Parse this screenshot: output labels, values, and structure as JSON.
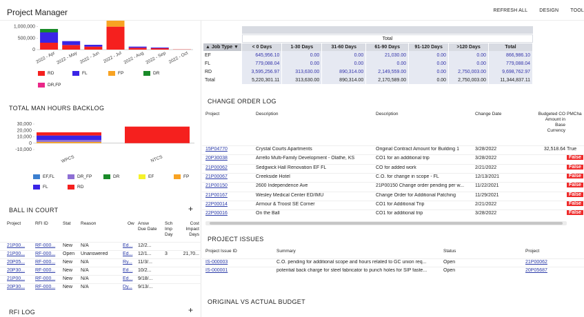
{
  "app": {
    "title": "Project Manager",
    "actions": [
      "REFRESH ALL",
      "DESIGN",
      "TOOL"
    ]
  },
  "colors": {
    "RD": "#f5201e",
    "FL": "#3a24e6",
    "FP": "#f8a323",
    "DR": "#198a28",
    "DR,FP": "#ea2788",
    "EF,FL": "#3b7fcf",
    "DR_FP": "#8e6fd4",
    "EF": "#f5f22a"
  },
  "invoice_chart": {
    "chart_data": {
      "type": "bar",
      "stacked": true,
      "categories": [
        "2022 - Apr",
        "2022 - May",
        "2022 - Jun",
        "2022 - Jul",
        "2022 - Aug",
        "2022 - Sep",
        "2022 - Oct"
      ],
      "series": [
        {
          "name": "RD",
          "values": [
            300000,
            200000,
            130000,
            1000000,
            80000,
            60000,
            10000
          ]
        },
        {
          "name": "FL",
          "values": [
            450000,
            170000,
            80000,
            0,
            50000,
            30000,
            0
          ]
        },
        {
          "name": "FP",
          "values": [
            0,
            0,
            0,
            450000,
            0,
            0,
            0
          ]
        },
        {
          "name": "DR",
          "values": [
            150000,
            0,
            0,
            0,
            0,
            0,
            0
          ]
        },
        {
          "name": "DR,FP",
          "values": [
            0,
            0,
            0,
            0,
            0,
            0,
            0
          ]
        }
      ],
      "ticks": [
        "0",
        "500,000",
        "1,000,000"
      ],
      "ylim": [
        0,
        1200000
      ],
      "legend": [
        "RD",
        "FL",
        "FP",
        "DR",
        "DR,FP"
      ]
    }
  },
  "backlog": {
    "title": "TOTAL MAN HOURS BACKLOG",
    "chart_data": {
      "type": "bar",
      "stacked": true,
      "categories": [
        "WPCS",
        "NTCS"
      ],
      "series": [
        {
          "name": "RD",
          "values": [
            5000,
            26000
          ]
        },
        {
          "name": "FL",
          "values": [
            7000,
            0
          ]
        },
        {
          "name": "DR_FP",
          "values": [
            3000,
            0
          ]
        },
        {
          "name": "FP",
          "values": [
            2000,
            0
          ]
        },
        {
          "name": "EF,FL",
          "values": [
            0,
            0
          ]
        }
      ],
      "ticks": [
        "-10,000",
        "0",
        "10,000",
        "20,000",
        "30,000"
      ],
      "ylim": [
        -10000,
        30000
      ],
      "legend": [
        "EF,FL",
        "DR_FP",
        "DR",
        "EF",
        "FP",
        "FL",
        "RD"
      ]
    }
  },
  "ball_in_court": {
    "title": "BALL IN COURT",
    "headers": [
      "Project",
      "RFI ID",
      "Stat",
      "Reason",
      "Ow",
      "Answ Due Date",
      "Sch Imp Day",
      "Cost Impact Days"
    ],
    "rows": [
      [
        "21P00...",
        "RF-000...",
        "New",
        "N/A",
        "Ed...",
        "12/2...",
        "",
        ""
      ],
      [
        "21P00...",
        "RF-000...",
        "Open",
        "Unanswered",
        "Ed...",
        "12/1...",
        "3",
        "21,70..."
      ],
      [
        "20P05...",
        "RF-000...",
        "New",
        "N/A",
        "Ry...",
        "11/3/...",
        "",
        ""
      ],
      [
        "20P30...",
        "RF-000...",
        "New",
        "N/A",
        "Ed...",
        "10/2...",
        "",
        ""
      ],
      [
        "21P00...",
        "RF-000...",
        "New",
        "N/A",
        "Ed...",
        "9/18/...",
        "",
        ""
      ],
      [
        "20P30...",
        "RF-000...",
        "New",
        "N/A",
        "Dy...",
        "9/13/...",
        "",
        ""
      ]
    ],
    "next_title": "RFI LOG"
  },
  "aging": {
    "super_header": "Total",
    "headers": [
      "Job Type",
      "< 0 Days",
      "1-30 Days",
      "31-60 Days",
      "61-90 Days",
      "91-120 Days",
      ">120 Days",
      "Total"
    ],
    "rows": [
      [
        "EF",
        "645,956.10",
        "0.00",
        "0.00",
        "21,030.00",
        "0.00",
        "0.00",
        "866,986.10"
      ],
      [
        "FL",
        "779,088.04",
        "0.00",
        "0.00",
        "0.00",
        "0.00",
        "0.00",
        "779,088.04"
      ],
      [
        "RD",
        "3,595,256.97",
        "313,630.00",
        "890,314.00",
        "2,149,559.00",
        "0.00",
        "2,750,003.00",
        "9,698,762.97"
      ],
      [
        "Total",
        "5,220,301.11",
        "313,630.00",
        "890,314.00",
        "2,170,589.00",
        "0.00",
        "2,750,003.00",
        "11,344,837.11"
      ]
    ]
  },
  "change_orders": {
    "title": "CHANGE ORDER LOG",
    "headers": [
      "Project",
      "Description",
      "Description",
      "Change Date",
      "Budgeted CO Amount in Base Currency",
      "PMCha"
    ],
    "rows": [
      [
        "15P04770",
        "Crystal Courts Apartments",
        "Original Contract Amount for Building 1",
        "3/28/2022",
        "32,518.64",
        "True"
      ],
      [
        "20P30038",
        "Arrello Multi-Family Development - Olathe, KS",
        "CO1 for an additional trip",
        "3/28/2022",
        "",
        "False"
      ],
      [
        "21P00062",
        "Sedgwick Hall Renovation EF FL",
        "CO for added work",
        "2/21/2022",
        "",
        "False"
      ],
      [
        "21P00067",
        "Creekside Hotel",
        "C.O. for change in scope - FL",
        "12/13/2021",
        "",
        "False"
      ],
      [
        "21P00150",
        "2600 Independence Ave",
        "21P00150 Change order pending per w...",
        "11/22/2021",
        "",
        "False"
      ],
      [
        "21P00167",
        "Wesley Medical Center ED/IMU",
        "Change Order for Additional Patching",
        "11/29/2021",
        "",
        "False"
      ],
      [
        "22P00014",
        "Armour & Troost SE Corner",
        "CO1 for Additional Trip",
        "2/21/2022",
        "",
        "False"
      ],
      [
        "22P00016",
        "On the Ball",
        "CO1 for additional trip",
        "3/28/2022",
        "",
        "False"
      ]
    ]
  },
  "issues": {
    "title": "PROJECT ISSUES",
    "headers": [
      "Project Issue ID",
      "Summary",
      "Status",
      "Project"
    ],
    "rows": [
      [
        "IS-000003",
        "C.O. pending for additional scope and hours related to GC union req...",
        "Open",
        "21P00062"
      ],
      [
        "IS-000001",
        "potential back charge for steel fabricator to punch holes for SIP faste...",
        "Open",
        "20P05687"
      ]
    ]
  },
  "budget": {
    "title": "ORIGINAL VS ACTUAL BUDGET"
  }
}
